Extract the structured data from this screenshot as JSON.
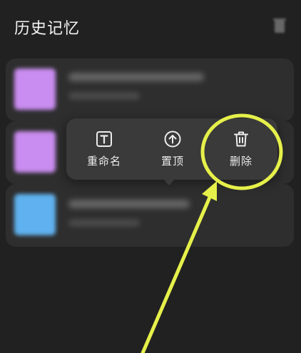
{
  "header": {
    "title": "历史记忆",
    "trash_icon": "trash-icon"
  },
  "history_list": [
    {
      "thumb_color": "#c98cf0"
    },
    {
      "thumb_color": "#c98cf0"
    },
    {
      "thumb_color": "#5fb2ef"
    }
  ],
  "context_menu": {
    "items": [
      {
        "label": "重命名",
        "icon": "rename-text-icon"
      },
      {
        "label": "置顶",
        "icon": "pin-top-icon"
      },
      {
        "label": "删除",
        "icon": "delete-trash-icon"
      }
    ]
  },
  "annotation": {
    "highlight_color": "#e6f04a",
    "target": "删除"
  }
}
